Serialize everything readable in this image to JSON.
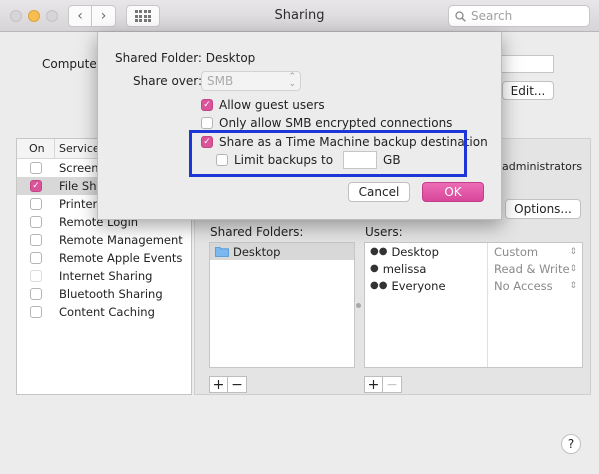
{
  "window": {
    "title": "Sharing",
    "search_placeholder": "Search"
  },
  "background": {
    "computer_label": "Computer",
    "edit_label": "Edit...",
    "services_header_on": "On",
    "services_header_service": "Service",
    "services": [
      {
        "label": "Screen",
        "on": false
      },
      {
        "label": "File Sha",
        "on": true
      },
      {
        "label": "Printer",
        "on": false
      },
      {
        "label": "Remote Login",
        "on": false
      },
      {
        "label": "Remote Management",
        "on": false
      },
      {
        "label": "Remote Apple Events",
        "on": false
      },
      {
        "label": "Internet Sharing",
        "on": false
      },
      {
        "label": "Bluetooth Sharing",
        "on": false
      },
      {
        "label": "Content Caching",
        "on": false
      }
    ],
    "administrators_text": "administrators",
    "options_label": "Options...",
    "shared_folders_label": "Shared Folders:",
    "shared_folders": [
      "Desktop"
    ],
    "users_label": "Users:",
    "users": [
      "Desktop",
      "melissa",
      "Everyone"
    ],
    "permissions": [
      "Custom",
      "Read & Write",
      "No Access"
    ],
    "plus": "+",
    "minus": "−",
    "help": "?"
  },
  "sheet": {
    "shared_folder_text": "Shared Folder: Desktop",
    "share_over_label": "Share over:",
    "share_over_value": "SMB",
    "allow_guest_label": "Allow guest users",
    "allow_guest_checked": true,
    "smb_encrypted_label": "Only allow SMB encrypted connections",
    "smb_encrypted_checked": false,
    "time_machine_label": "Share as a Time Machine backup destination",
    "time_machine_checked": true,
    "limit_backups_label": "Limit backups to",
    "limit_backups_checked": false,
    "limit_value": "",
    "gb_label": "GB",
    "cancel_label": "Cancel",
    "ok_label": "OK",
    "highlight_color": "#1c36d8",
    "accent_color": "#d9559a"
  }
}
